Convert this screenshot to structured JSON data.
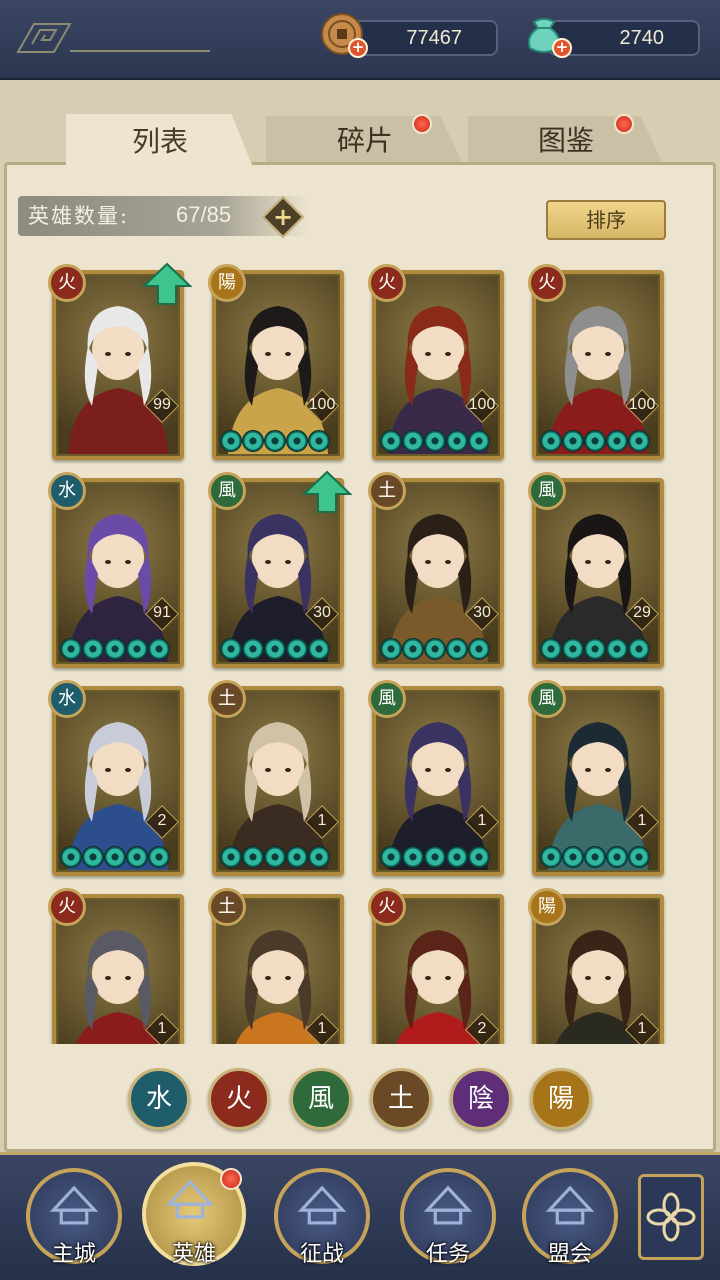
{
  "resources": {
    "coins": "77467",
    "gems": "2740"
  },
  "tabs": [
    {
      "label": "列表",
      "active": true,
      "badge": false
    },
    {
      "label": "碎片",
      "active": false,
      "badge": true
    },
    {
      "label": "图鉴",
      "active": false,
      "badge": true
    }
  ],
  "hero_count": {
    "label": "英雄数量:",
    "value": "67/85"
  },
  "sort_label": "排序",
  "element_colors": {
    "火": "#8c2a1e",
    "陽": "#a8741a",
    "水": "#1f5d6a",
    "風": "#2e6a3a",
    "土": "#6a4a26",
    "陰": "#5e2f78"
  },
  "heroes": [
    {
      "element": "火",
      "level": "99",
      "stars": 0,
      "upgrade": true,
      "hair": "#e8e8e8",
      "robe": "#7a1e1e"
    },
    {
      "element": "陽",
      "level": "100",
      "stars": 5,
      "upgrade": false,
      "hair": "#1e1a1a",
      "robe": "#c9a449"
    },
    {
      "element": "火",
      "level": "100",
      "stars": 5,
      "upgrade": false,
      "hair": "#8a2a18",
      "robe": "#3a2a4a"
    },
    {
      "element": "火",
      "level": "100",
      "stars": 5,
      "upgrade": false,
      "hair": "#8e8e8e",
      "robe": "#8a1c1c"
    },
    {
      "element": "水",
      "level": "91",
      "stars": 5,
      "upgrade": false,
      "hair": "#6a4ca8",
      "robe": "#2e2440"
    },
    {
      "element": "風",
      "level": "30",
      "stars": 5,
      "upgrade": true,
      "hair": "#3a3260",
      "robe": "#1e1e2a"
    },
    {
      "element": "土",
      "level": "30",
      "stars": 5,
      "upgrade": false,
      "hair": "#2a2018",
      "robe": "#7a5a2a"
    },
    {
      "element": "風",
      "level": "29",
      "stars": 5,
      "upgrade": false,
      "hair": "#1a1616",
      "robe": "#2a2a2a"
    },
    {
      "element": "水",
      "level": "2",
      "stars": 5,
      "upgrade": false,
      "hair": "#c8ccd8",
      "robe": "#2c4e8c"
    },
    {
      "element": "土",
      "level": "1",
      "stars": 5,
      "upgrade": false,
      "hair": "#cfc2a6",
      "robe": "#3a2c20"
    },
    {
      "element": "風",
      "level": "1",
      "stars": 5,
      "upgrade": false,
      "hair": "#3a3260",
      "robe": "#1e1e2a"
    },
    {
      "element": "風",
      "level": "1",
      "stars": 5,
      "upgrade": false,
      "hair": "#1c2a34",
      "robe": "#3a6a6a"
    },
    {
      "element": "火",
      "level": "1",
      "stars": 0,
      "upgrade": false,
      "hair": "#5a5a64",
      "robe": "#8a1c1c"
    },
    {
      "element": "土",
      "level": "1",
      "stars": 0,
      "upgrade": false,
      "hair": "#4a3a2a",
      "robe": "#c9761e"
    },
    {
      "element": "火",
      "level": "2",
      "stars": 0,
      "upgrade": false,
      "hair": "#5a2418",
      "robe": "#b01c1c"
    },
    {
      "element": "陽",
      "level": "1",
      "stars": 0,
      "upgrade": false,
      "hair": "#3a2418",
      "robe": "#2a2a20"
    }
  ],
  "element_filters": [
    "水",
    "火",
    "風",
    "土",
    "陰",
    "陽"
  ],
  "nav": [
    {
      "label": "主城",
      "icon": "palace-icon",
      "active": false,
      "badge": false
    },
    {
      "label": "英雄",
      "icon": "hero-avatar-icon",
      "active": true,
      "badge": true
    },
    {
      "label": "征战",
      "icon": "battle-icon",
      "active": false,
      "badge": false
    },
    {
      "label": "任务",
      "icon": "scroll-icon",
      "active": false,
      "badge": false
    },
    {
      "label": "盟会",
      "icon": "pavilion-icon",
      "active": false,
      "badge": false
    }
  ]
}
